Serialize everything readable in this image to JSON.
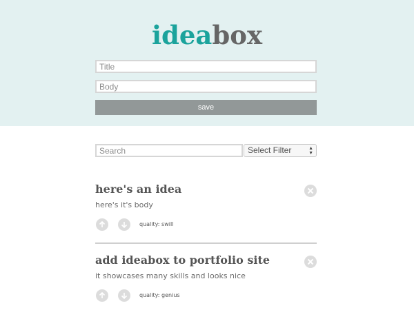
{
  "app": {
    "logo_part1": "idea",
    "logo_part2": "box",
    "accent_color": "#1ba39c",
    "header_bg": "#e3f1f1"
  },
  "form": {
    "title_placeholder": "Title",
    "body_placeholder": "Body",
    "save_label": "save"
  },
  "controls": {
    "search_placeholder": "Search",
    "filter_selected": "Select Filter"
  },
  "ideas": [
    {
      "title": "here's an idea",
      "body": "here's it's body",
      "quality": "quality: swill"
    },
    {
      "title": "add ideabox to portfolio site",
      "body": "it showcases many skills and looks nice",
      "quality": "quality: genius"
    }
  ],
  "icons": {
    "delete": "close-circle-icon",
    "upvote": "arrow-up-circle-icon",
    "downvote": "arrow-down-circle-icon",
    "filter_arrows": "select-arrows-icon"
  }
}
